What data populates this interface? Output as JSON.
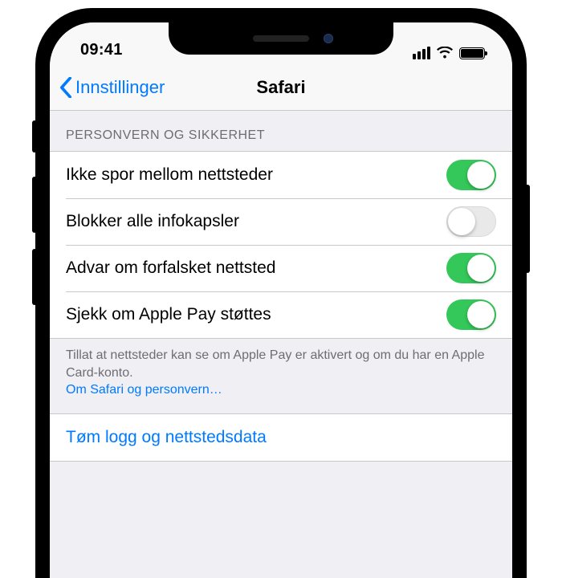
{
  "statusbar": {
    "time": "09:41"
  },
  "nav": {
    "back": "Innstillinger",
    "title": "Safari"
  },
  "section": {
    "header": "PERSONVERN OG SIKKERHET",
    "rows": [
      {
        "label": "Ikke spor mellom nettsteder",
        "on": true
      },
      {
        "label": "Blokker alle infokapsler",
        "on": false
      },
      {
        "label": "Advar om forfalsket nettsted",
        "on": true
      },
      {
        "label": "Sjekk om Apple Pay støttes",
        "on": true
      }
    ],
    "footer": "Tillat at nettsteder kan se om Apple Pay er aktivert og om du har en Apple Card-konto.",
    "footer_link": "Om Safari og personvern…"
  },
  "clear_row": {
    "label": "Tøm logg og nettstedsdata"
  }
}
